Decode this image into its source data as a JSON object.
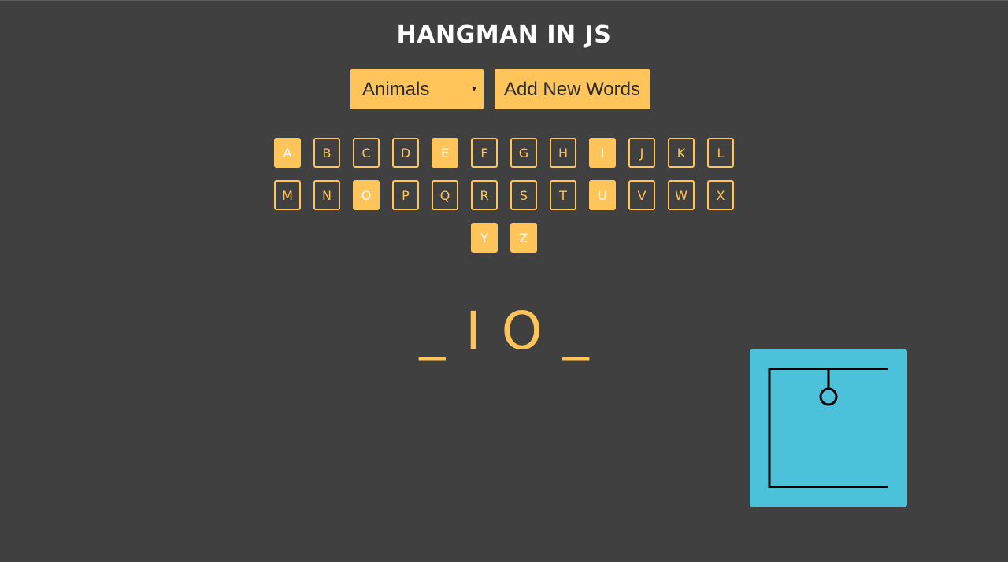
{
  "title": "HANGMAN IN JS",
  "category_select": {
    "selected": "Animals"
  },
  "add_words_button": "Add New Words",
  "letter_rows": [
    [
      {
        "letter": "A",
        "used": true
      },
      {
        "letter": "B",
        "used": false
      },
      {
        "letter": "C",
        "used": false
      },
      {
        "letter": "D",
        "used": false
      },
      {
        "letter": "E",
        "used": true
      },
      {
        "letter": "F",
        "used": false
      },
      {
        "letter": "G",
        "used": false
      },
      {
        "letter": "H",
        "used": false
      },
      {
        "letter": "I",
        "used": true
      },
      {
        "letter": "J",
        "used": false
      },
      {
        "letter": "K",
        "used": false
      },
      {
        "letter": "L",
        "used": false
      }
    ],
    [
      {
        "letter": "M",
        "used": false
      },
      {
        "letter": "N",
        "used": false
      },
      {
        "letter": "O",
        "used": true
      },
      {
        "letter": "P",
        "used": false
      },
      {
        "letter": "Q",
        "used": false
      },
      {
        "letter": "R",
        "used": false
      },
      {
        "letter": "S",
        "used": false
      },
      {
        "letter": "T",
        "used": false
      },
      {
        "letter": "U",
        "used": true
      },
      {
        "letter": "V",
        "used": false
      },
      {
        "letter": "W",
        "used": false
      },
      {
        "letter": "X",
        "used": false
      }
    ],
    [
      {
        "letter": "Y",
        "used": true
      },
      {
        "letter": "Z",
        "used": true
      }
    ]
  ],
  "word_slots": [
    "_",
    "I",
    "O",
    "_"
  ],
  "colors": {
    "background": "#404040",
    "accent": "#ffc45a",
    "title": "#ffffff",
    "canvas": "#4bc2da"
  }
}
